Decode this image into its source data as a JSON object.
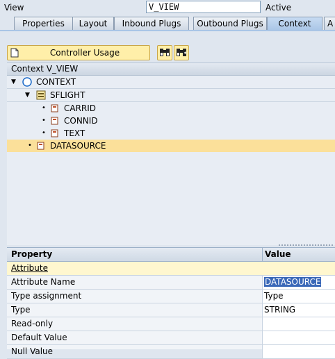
{
  "header": {
    "view_label": "View",
    "view_value": "V_VIEW",
    "status": "Active"
  },
  "tabs": [
    {
      "label": "Properties",
      "active": false
    },
    {
      "label": "Layout",
      "active": false
    },
    {
      "label": "Inbound Plugs",
      "active": false
    },
    {
      "label": "Outbound Plugs",
      "active": false
    },
    {
      "label": "Context",
      "active": true
    },
    {
      "label": "A",
      "active": false
    }
  ],
  "toolbar": {
    "controller_usage_label": "Controller Usage"
  },
  "tree": {
    "header": "Context V_VIEW",
    "nodes": [
      {
        "label": "CONTEXT",
        "icon": "context-root-icon",
        "expanded": true
      },
      {
        "label": "SFLIGHT",
        "icon": "node-icon",
        "expanded": true
      },
      {
        "label": "CARRID",
        "icon": "attribute-icon"
      },
      {
        "label": "CONNID",
        "icon": "attribute-icon"
      },
      {
        "label": "TEXT",
        "icon": "attribute-icon"
      },
      {
        "label": "DATASOURCE",
        "icon": "attribute-icon",
        "selected": true
      }
    ]
  },
  "properties": {
    "col_property": "Property",
    "col_value": "Value",
    "section": "Attribute",
    "rows": [
      {
        "property": "Attribute Name",
        "value": "DATASOURCE"
      },
      {
        "property": "Type assignment",
        "value": "Type"
      },
      {
        "property": "Type",
        "value": "STRING"
      },
      {
        "property": "Read-only",
        "value": ""
      },
      {
        "property": "Default Value",
        "value": ""
      },
      {
        "property": "Null Value",
        "value": ""
      }
    ]
  },
  "colors": {
    "selection": "#fbe09a",
    "button": "#ffefa9",
    "active_tab": "#a9c5e6",
    "highlight": "#3a68b8"
  }
}
